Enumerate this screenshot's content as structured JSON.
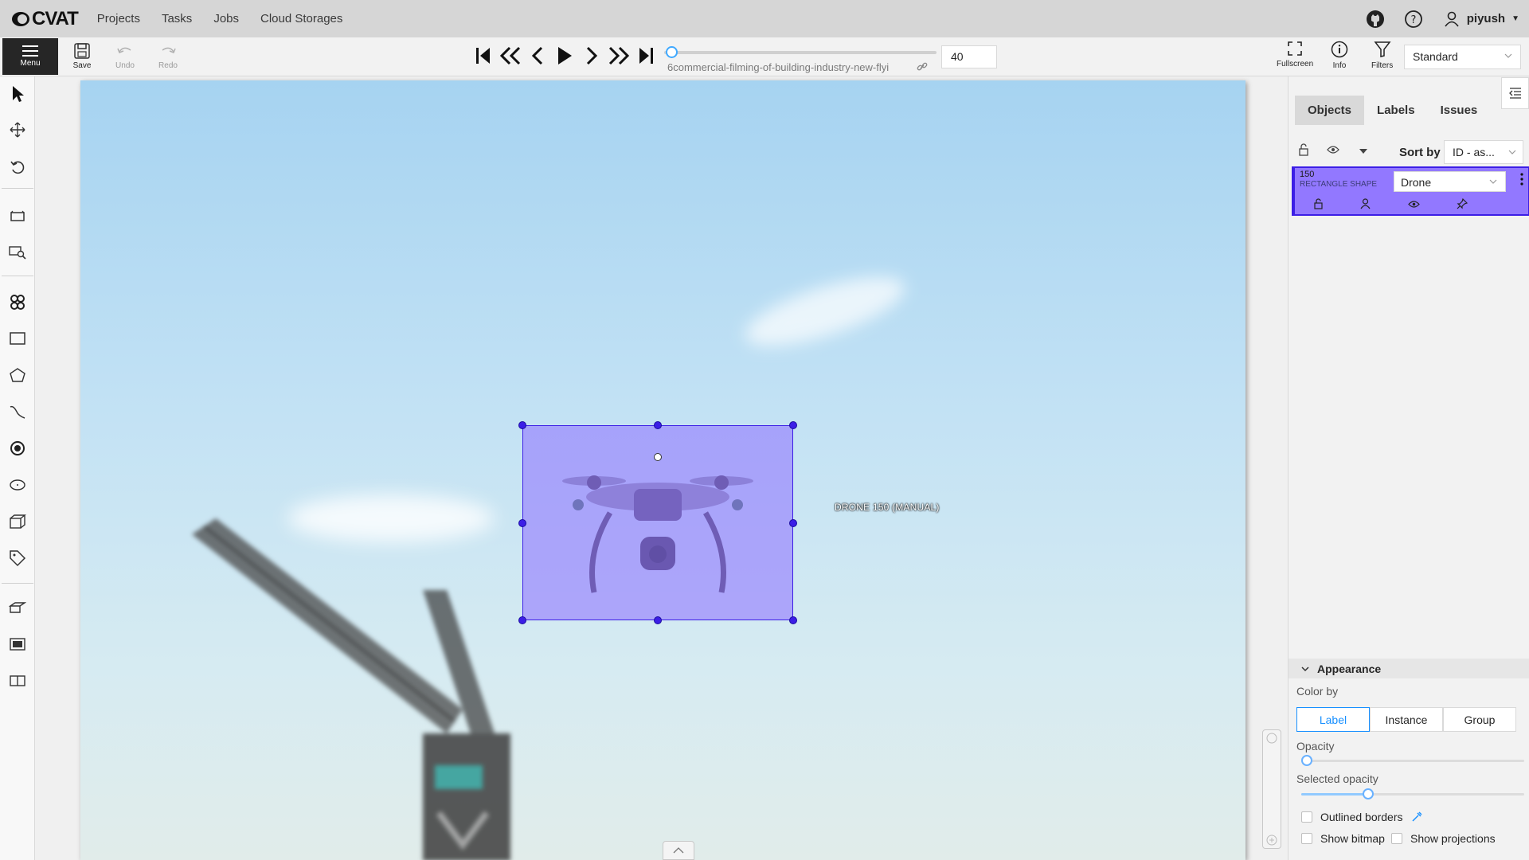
{
  "app": {
    "logo_text": "CVAT"
  },
  "nav": {
    "items": [
      "Projects",
      "Tasks",
      "Jobs",
      "Cloud Storages"
    ]
  },
  "user": {
    "name": "piyush"
  },
  "toolbar": {
    "menu_label": "Menu",
    "save_label": "Save",
    "undo_label": "Undo",
    "redo_label": "Redo",
    "frame_number": "40",
    "frame_progress": 0.03,
    "filename": "6commercial-filming-of-building-industry-new-flyi",
    "fullscreen_label": "Fullscreen",
    "info_label": "Info",
    "filters_label": "Filters",
    "workspace": "Standard"
  },
  "canvas": {
    "annotation_label": "DRONE 150 (MANUAL)",
    "annotation_color": "#3c1ee6",
    "annotation_fill": "#9278ff"
  },
  "right_panel": {
    "tabs": [
      "Objects",
      "Labels",
      "Issues"
    ],
    "sort_by_label": "Sort by",
    "sort_by_value": "ID - as...",
    "object": {
      "id": "150",
      "type": "RECTANGLE SHAPE",
      "label": "Drone"
    },
    "appearance": {
      "title": "Appearance",
      "color_by_label": "Color by",
      "color_by_options": [
        "Label",
        "Instance",
        "Group"
      ],
      "color_by_selected": "Label",
      "opacity_label": "Opacity",
      "opacity_value": 0.0,
      "selected_opacity_label": "Selected opacity",
      "selected_opacity_value": 0.3,
      "outlined_borders_label": "Outlined borders",
      "show_bitmap_label": "Show bitmap",
      "show_projections_label": "Show projections"
    }
  },
  "colors": {
    "accent": "#1890ff",
    "menu_bg": "#262626"
  }
}
